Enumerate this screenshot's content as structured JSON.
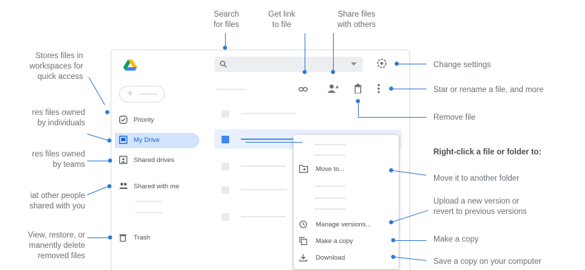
{
  "colors": {
    "accent": "#2f7ad8",
    "nav_active_bg": "#d2e3fc",
    "nav_active_text": "#1967d2"
  },
  "left_annotations": {
    "stores_files": "Stores files in\nworkspaces for\nquick access",
    "my_drive": "res files owned\nby individuals",
    "shared_drives": "res files owned\nby teams",
    "shared_with_me": "iat other people\nshared with you",
    "trash": "View, restore, or\nmanently delete\nremoved files"
  },
  "top_annotations": {
    "search": "Search\nfor files",
    "get_link": "Get link\nto file",
    "share": "Share files\nwith others"
  },
  "right_annotations": {
    "settings": "Change settings",
    "star_rename": "Star or rename a file, and more",
    "remove": "Remove file",
    "right_click_heading": "Right-click a file or folder to:",
    "move": "Move it to another folder",
    "upload_version": "Upload a new version or\nrevert to previous versions",
    "make_copy": "Make a copy",
    "download": "Save a copy on your computer"
  },
  "search": {
    "icon": "search-icon",
    "dropdown_icon": "caret-down-icon"
  },
  "nav": {
    "new_icon": "plus-icon",
    "items": [
      {
        "label": "Priority",
        "icon": "check-circle-icon"
      },
      {
        "label": "My Drive",
        "icon": "drive-icon",
        "active": true
      },
      {
        "label": "Shared drives",
        "icon": "shared-drive-icon"
      },
      {
        "label": "Shared with me",
        "icon": "people-icon"
      },
      {
        "label": "Trash",
        "icon": "trash-icon"
      }
    ]
  },
  "toolbar": {
    "icons": [
      "link-icon",
      "person-add-icon",
      "trash-icon",
      "more-vert-icon",
      "gear-icon"
    ]
  },
  "context_menu": {
    "items": [
      {
        "label": "Move to...",
        "icon": "move-folder-icon"
      },
      {
        "label": "Manage versions...",
        "icon": "history-icon"
      },
      {
        "label": "Make a copy",
        "icon": "copy-icon"
      },
      {
        "label": "Download",
        "icon": "download-icon"
      }
    ]
  }
}
